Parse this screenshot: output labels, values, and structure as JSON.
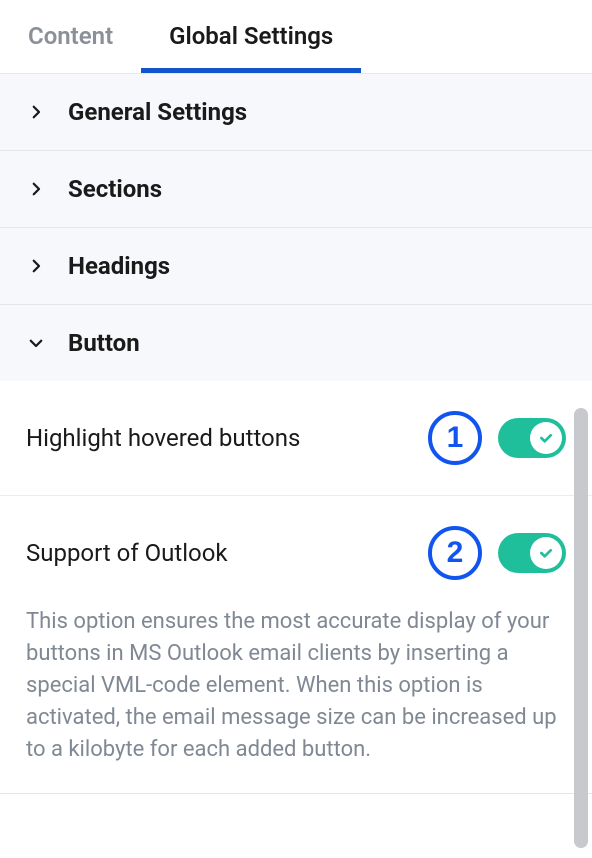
{
  "tabs": {
    "content": "Content",
    "global": "Global Settings"
  },
  "sections": {
    "general": "General Settings",
    "sections": "Sections",
    "headings": "Headings",
    "button": "Button"
  },
  "button_panel": {
    "highlight_label": "Highlight hovered buttons",
    "outlook_label": "Support of Outlook",
    "outlook_desc": "This option ensures the most accurate display of your buttons in MS Outlook email clients by inserting a special VML-code element. When this option is activated, the email message size can be increased up to a kilobyte for each added button."
  },
  "annotations": {
    "one": "1",
    "two": "2"
  }
}
